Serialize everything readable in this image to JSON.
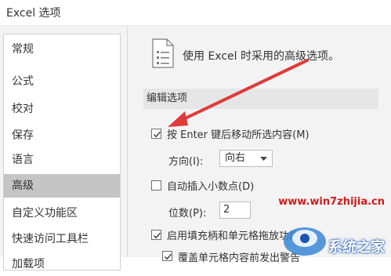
{
  "window": {
    "title": "Excel 选项"
  },
  "sidebar": {
    "items": [
      {
        "label": "常规"
      },
      {
        "label": "公式"
      },
      {
        "label": "校对"
      },
      {
        "label": "保存"
      },
      {
        "label": "语言"
      },
      {
        "label": "高级",
        "selected": true
      },
      {
        "label": "自定义功能区"
      },
      {
        "label": "快速访问工具栏"
      },
      {
        "label": "加载项"
      }
    ]
  },
  "main": {
    "header_text": "使用 Excel 时采用的高级选项。",
    "section_title": "编辑选项",
    "options": {
      "move_after_enter": {
        "label": "按 Enter 键后移动所选内容(M)",
        "checked": true
      },
      "direction": {
        "label": "方向(I):",
        "value": "向右"
      },
      "auto_decimal": {
        "label": "自动插入小数点(D)",
        "checked": false
      },
      "places": {
        "label": "位数(P):",
        "value": "2"
      },
      "fill_handle": {
        "label": "启用填充柄和单元格拖放功能",
        "checked": true
      },
      "alert_overwrite": {
        "label": "覆盖单元格内容前发出警告",
        "checked": true
      }
    }
  },
  "watermark": {
    "url": "www.win7zhijia.cn",
    "brand": "系统之家"
  },
  "colors": {
    "accent_arrow": "#e03a3a",
    "sidebar_selected": "#c5c5c5",
    "watermark_red": "#d11a1a"
  }
}
